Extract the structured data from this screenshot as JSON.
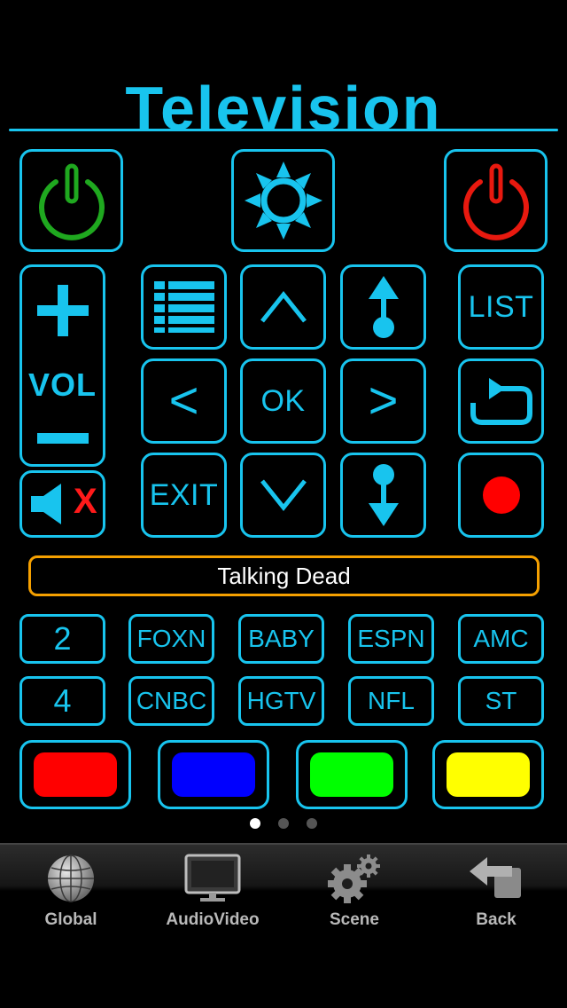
{
  "header": {
    "title": "Television"
  },
  "top_row": {
    "power_on_icon": "power-icon-green",
    "brightness_icon": "sun-icon",
    "power_off_icon": "power-icon-red"
  },
  "volume": {
    "label": "VOL",
    "up_icon": "plus-icon",
    "down_icon": "minus-icon"
  },
  "mute": {
    "icon": "speaker-muted-icon",
    "mark": "X"
  },
  "nav": {
    "ok": "OK",
    "exit": "EXIT",
    "list": "LIST",
    "left": "<",
    "right": ">",
    "up_icon": "chevron-up-icon",
    "down_icon": "chevron-down-icon",
    "menu_icon": "menu-list-icon",
    "channel_up_icon": "channel-up-icon",
    "channel_down_icon": "channel-down-icon",
    "back_icon": "return-icon",
    "record_icon": "record-icon"
  },
  "now_playing": "Talking Dead",
  "channels": [
    [
      "2",
      "FOXN",
      "BABY",
      "ESPN",
      "AMC"
    ],
    [
      "4",
      "CNBC",
      "HGTV",
      "NFL",
      "ST"
    ]
  ],
  "color_buttons": [
    {
      "name": "red",
      "color": "#ff0000"
    },
    {
      "name": "blue",
      "color": "#0000ff"
    },
    {
      "name": "green",
      "color": "#00ff00"
    },
    {
      "name": "yellow",
      "color": "#ffff00"
    }
  ],
  "colors": {
    "accent": "#18c4ee",
    "highlight": "#f5a000",
    "power_on": "#1fa81f",
    "power_off": "#e8190f",
    "record": "#ff0000"
  },
  "page_indicator": {
    "pages": 3,
    "current": 1
  },
  "tabbar": {
    "items": [
      {
        "label": "Global",
        "icon": "globe-icon"
      },
      {
        "label": "AudioVideo",
        "icon": "monitor-icon"
      },
      {
        "label": "Scene",
        "icon": "gears-icon"
      },
      {
        "label": "Back",
        "icon": "back-arrow-icon"
      }
    ]
  }
}
